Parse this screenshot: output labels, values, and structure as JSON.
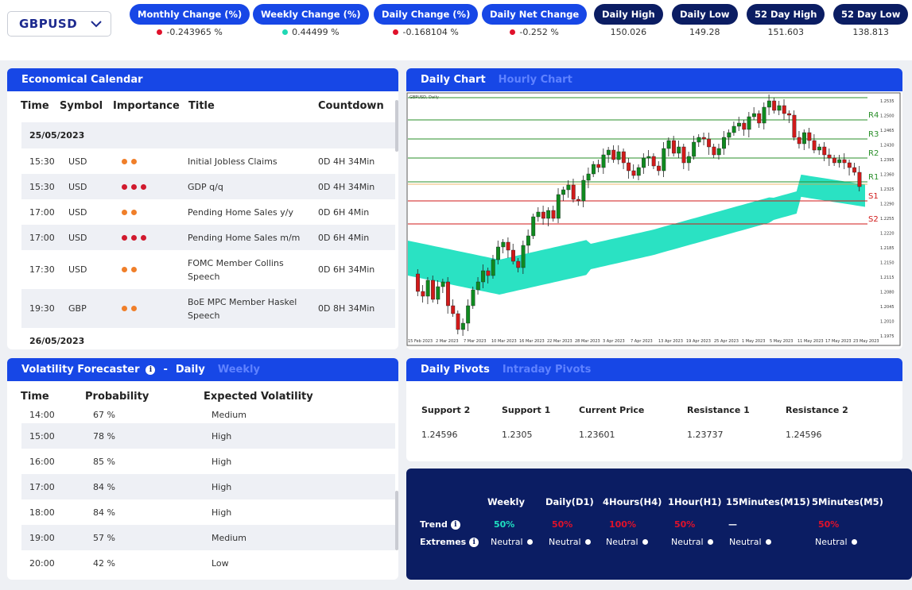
{
  "symbol": "GBPUSD",
  "stats": [
    {
      "label": "Monthly Change (%)",
      "value": "-0.243965 %",
      "dot": "#e0112b"
    },
    {
      "label": "Weekly Change (%)",
      "value": "0.44499 %",
      "dot": "#1fd8b4"
    },
    {
      "label": "Daily Change (%)",
      "value": "-0.168104 %",
      "dot": "#e0112b"
    },
    {
      "label": "Daily Net Change",
      "value": "-0.252 %",
      "dot": "#e0112b"
    },
    {
      "label": "Daily High",
      "value": "150.026"
    },
    {
      "label": "Daily Low",
      "value": "149.28"
    },
    {
      "label": "52 Day High",
      "value": "151.603"
    },
    {
      "label": "52 Day Low",
      "value": "138.813"
    }
  ],
  "calendar": {
    "title": "Economical Calendar",
    "columns": [
      "Time",
      "Symbol",
      "Importance",
      "Title",
      "Countdown"
    ],
    "date1": "25/05/2023",
    "date2": "26/05/2023",
    "rows": [
      {
        "time": "15:30",
        "symbol": "USD",
        "importance": 2,
        "title": "Initial Jobless Claims",
        "countdown": "0D 4H 34Min"
      },
      {
        "time": "15:30",
        "symbol": "USD",
        "importance": 3,
        "title": "GDP q/q",
        "countdown": "0D 4H 34Min"
      },
      {
        "time": "17:00",
        "symbol": "USD",
        "importance": 2,
        "title": "Pending Home Sales y/y",
        "countdown": "0D 6H 4Min"
      },
      {
        "time": "17:00",
        "symbol": "USD",
        "importance": 3,
        "title": "Pending Home Sales m/m",
        "countdown": "0D 6H 4Min"
      },
      {
        "time": "17:30",
        "symbol": "USD",
        "importance": 2,
        "title": "FOMC Member Collins Speech",
        "countdown": "0D 6H 34Min"
      },
      {
        "time": "19:30",
        "symbol": "GBP",
        "importance": 2,
        "title": "BoE MPC Member Haskel Speech",
        "countdown": "0D 8H 34Min"
      }
    ]
  },
  "chart": {
    "tab_active": "Daily Chart",
    "tab_inactive": "Hourly Chart",
    "header_text": "GBPUSD, Daily",
    "levels": [
      "R4",
      "R3",
      "R2",
      "R1",
      "S1",
      "S2"
    ],
    "dates": [
      "15 Feb 2023",
      "2 Mar 2023",
      "7 Mar 2023",
      "10 Mar 2023",
      "16 Mar 2023",
      "22 Mar 2023",
      "28 Mar 2023",
      "3 Apr 2023",
      "7 Apr 2023",
      "13 Apr 2023",
      "19 Apr 2023",
      "25 Apr 2023",
      "1 May 2023",
      "5 May 2023",
      "11 May 2023",
      "17 May 2023",
      "23 May 2023"
    ],
    "prices": [
      "1.2535",
      "1.2500",
      "1.2465",
      "1.2430",
      "1.2395",
      "1.2360",
      "1.2325",
      "1.2290",
      "1.2255",
      "1.2220",
      "1.2185",
      "1.2150",
      "1.2115",
      "1.2080",
      "1.2045",
      "1.2010",
      "1.1975"
    ],
    "colors": {
      "up": "#0f8a1f",
      "down": "#d11a1a",
      "band": "#1fe0c0",
      "resistance": "#2a8f2a",
      "support": "#d11a1a"
    }
  },
  "volatility": {
    "title": "Volatility Forecaster",
    "separator": "-",
    "tab_active": "Daily",
    "tab_inactive": "Weekly",
    "columns": [
      "Time",
      "Probability",
      "Expected Volatility"
    ],
    "rows": [
      {
        "time": "14:00",
        "prob": "67 %",
        "exp": "Medium"
      },
      {
        "time": "15:00",
        "prob": "78 %",
        "exp": "High"
      },
      {
        "time": "16:00",
        "prob": "85 %",
        "exp": "High"
      },
      {
        "time": "17:00",
        "prob": "84 %",
        "exp": "High"
      },
      {
        "time": "18:00",
        "prob": "84 %",
        "exp": "High"
      },
      {
        "time": "19:00",
        "prob": "57 %",
        "exp": "Medium"
      },
      {
        "time": "20:00",
        "prob": "42 %",
        "exp": "Low"
      }
    ]
  },
  "pivots": {
    "tab_active": "Daily Pivots",
    "tab_inactive": "Intraday Pivots",
    "labels": [
      "Support 2",
      "Support 1",
      "Current Price",
      "Resistance 1",
      "Resistance 2"
    ],
    "values": [
      "1.24596",
      "1.2305",
      "1.23601",
      "1.23737",
      "1.24596"
    ]
  },
  "trend": {
    "headers": [
      "Weekly",
      "Daily(D1)",
      "4Hours(H4)",
      "1Hour(H1)",
      "15Minutes(M15)",
      "5Minutes(M5)"
    ],
    "trend_label": "Trend",
    "extremes_label": "Extremes",
    "trend_values": [
      "50%",
      "50%",
      "100%",
      "50%",
      "—",
      "50%"
    ],
    "trend_colors": [
      "#1fe0c0",
      "#e0112b",
      "#e0112b",
      "#e0112b",
      "#ffffff",
      "#e0112b"
    ],
    "extremes": [
      "Neutral",
      "Neutral",
      "Neutral",
      "Neutral",
      "Neutral",
      "Neutral"
    ]
  },
  "importance_colors": {
    "2": "#f07f2a",
    "3": "#d11a2e"
  }
}
